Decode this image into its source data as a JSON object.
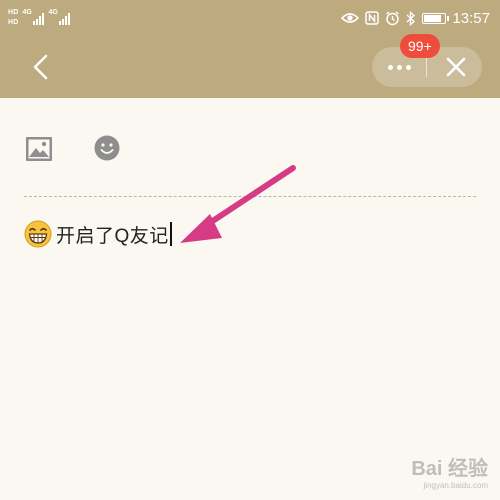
{
  "status_bar": {
    "hd_labels": [
      "HD",
      "HD"
    ],
    "network_labels": [
      "4G",
      "4G"
    ],
    "time": "13:57",
    "battery_level": 0.85,
    "icons": [
      "eye-icon",
      "nfc-icon",
      "alarm-icon",
      "bluetooth-icon",
      "battery-icon"
    ]
  },
  "nav": {
    "back_icon": "chevron-left-icon",
    "more_icon": "more-dots-icon",
    "close_icon": "close-icon",
    "notification_badge": "99+"
  },
  "toolbar": {
    "image_icon": "image-icon",
    "emoji_icon": "emoji-icon"
  },
  "editor": {
    "leading_emoji": "grinning-face-icon",
    "text": "开启了Q友记"
  },
  "watermark": {
    "main": "Bai 经验",
    "sub": "jingyan.baidu.com"
  },
  "colors": {
    "header": "#bdaa7f",
    "background": "#fbf8f2",
    "badge": "#ef4d3c",
    "arrow": "#d63b86"
  }
}
